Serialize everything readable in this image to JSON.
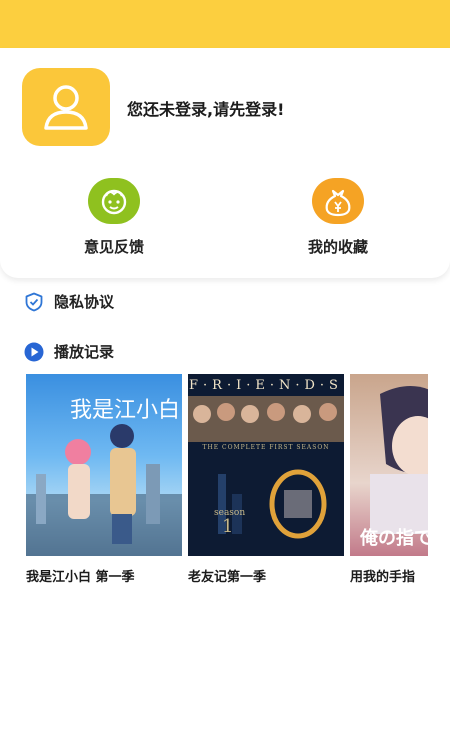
{
  "header": {
    "bg_color": "#fccf3f"
  },
  "profile": {
    "login_prompt": "您还未登录,请先登录!"
  },
  "quick_actions": [
    {
      "label": "意见反馈",
      "icon": "feedback-face-icon",
      "color": "#8fc11f"
    },
    {
      "label": "我的收藏",
      "icon": "money-bag-icon",
      "color": "#f5a324"
    }
  ],
  "menu": {
    "privacy": {
      "label": "隐私协议",
      "icon": "shield-check-icon"
    },
    "history": {
      "label": "播放记录",
      "icon": "play-circle-icon"
    }
  },
  "history_items": [
    {
      "title": "我是江小白 第一季",
      "poster_text": "我是江小白"
    },
    {
      "title": "老友记第一季",
      "poster_text": "F·R·I·E·N·D·S",
      "poster_subtext": "THE COMPLETE FIRST SEASON",
      "season_label": "season"
    },
    {
      "title": "用我的手指",
      "poster_text": "俺の指で"
    }
  ]
}
